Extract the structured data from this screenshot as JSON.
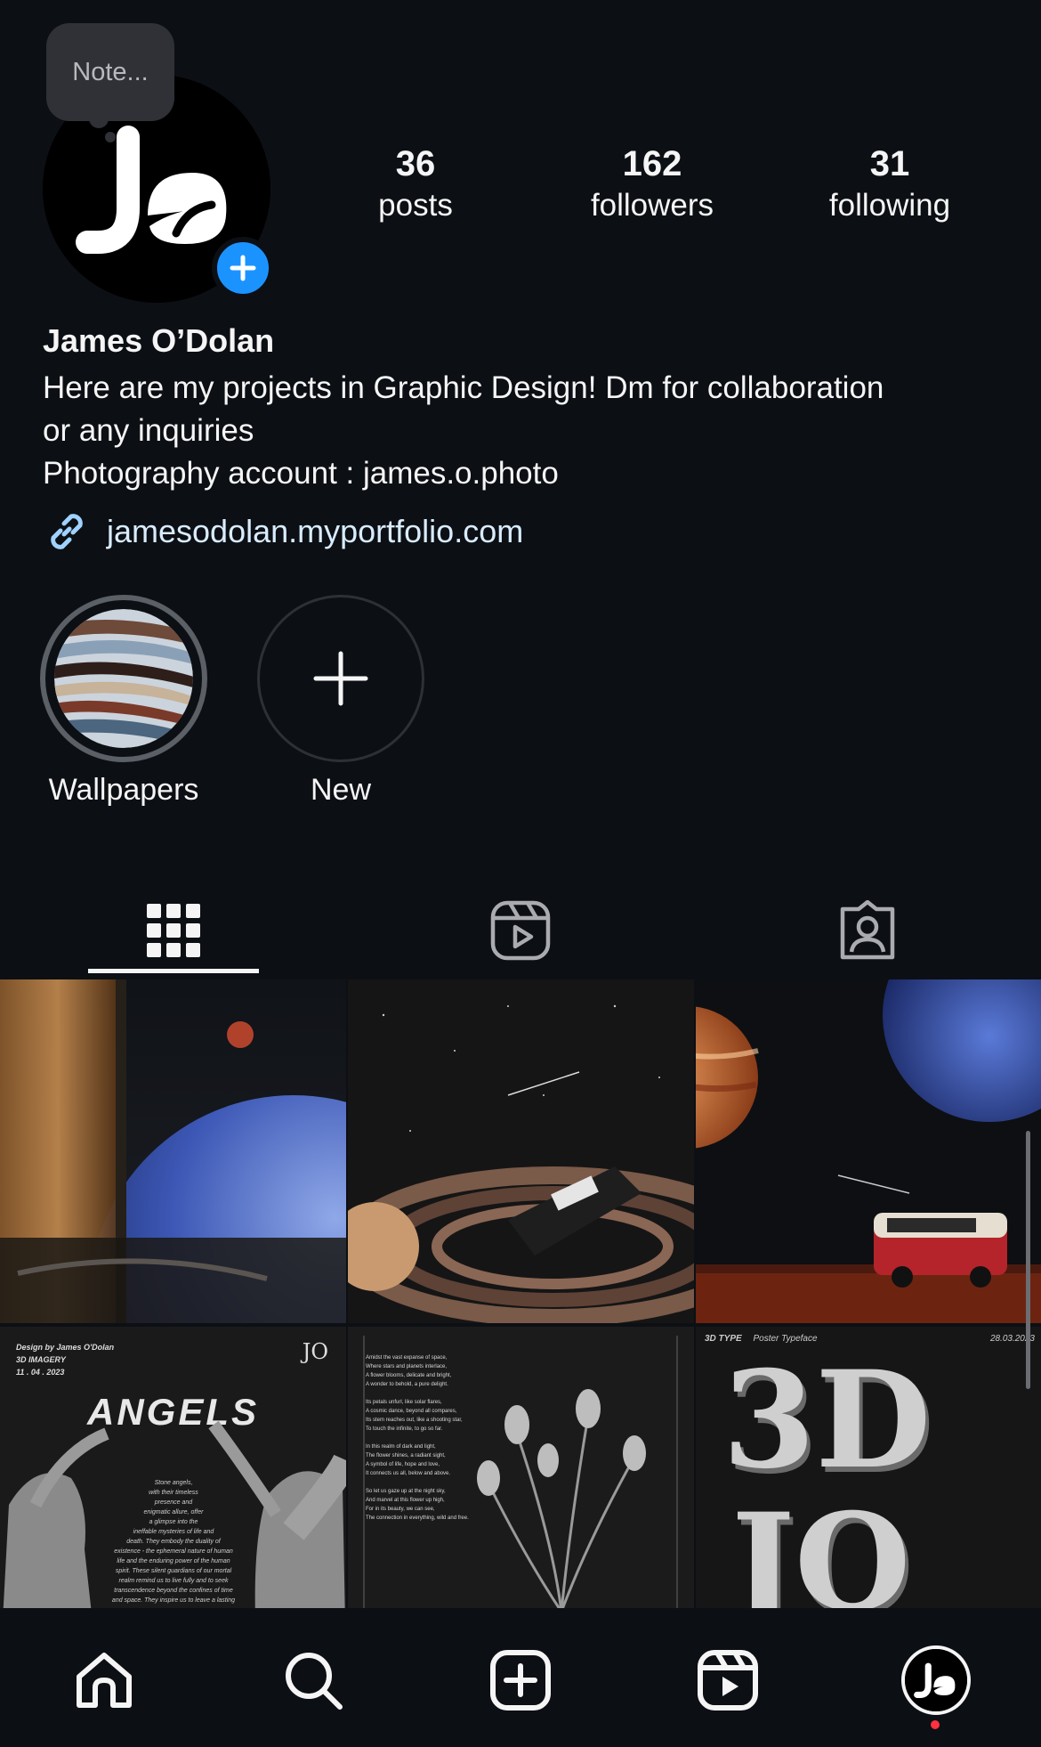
{
  "note": {
    "placeholder": "Note..."
  },
  "stats": [
    {
      "count": "36",
      "label": "posts"
    },
    {
      "count": "162",
      "label": "followers"
    },
    {
      "count": "31",
      "label": "following"
    }
  ],
  "profile": {
    "name": "James O’Dolan",
    "bio_lines": [
      "Here are my projects in Graphic Design! Dm for collaboration",
      "or any inquiries",
      "Photography account : james.o.photo"
    ],
    "link": "jamesodolan.myportfolio.com",
    "avatar_text": "Jo"
  },
  "highlights": [
    {
      "label": "Wallpapers"
    },
    {
      "label": "New"
    }
  ],
  "tabs": [
    {
      "icon": "grid-icon",
      "selected": true
    },
    {
      "icon": "reels-icon",
      "selected": false
    },
    {
      "icon": "tagged-icon",
      "selected": false
    }
  ],
  "posts": {
    "angels": {
      "credit": "Design by James O'Dolan",
      "subtitle": "3D IMAGERY",
      "date": "11 . 04 . 2023",
      "title": "ANGELS",
      "logo": "JO",
      "body": [
        "Stone angels,",
        "with their timeless",
        "presence and",
        "enigmatic allure, offer",
        "a glimpse into the",
        "ineffable mysteries of life and",
        "death. They embody the duality of",
        "existence - the ephemeral nature of human",
        "life and the enduring power of the human",
        "spirit. These silent guardians of our mortal",
        "realm remind us to live fully and to seek",
        "transcendence beyond the confines of time",
        "and space. They inspire us to leave a lasting"
      ]
    },
    "poem": {
      "lines": [
        "Amidst the vast expanse of space,",
        "Where stars and planets interlace,",
        "A flower blooms, delicate and bright,",
        "A wonder to behold, a pure delight.",
        "",
        "Its petals unfurl, like solar flares,",
        "A cosmic dance, beyond all compares,",
        "Its stem reaches out, like a shooting star,",
        "To touch the infinite, to go so far.",
        "",
        "In this realm of dark and light,",
        "The flower shines, a radiant sight,",
        "A symbol of life, hope and love,",
        "It connects us all, below and above.",
        "",
        "So let us gaze up at the night sky,",
        "And marvel at this flower up high,",
        "For in its beauty, we can see,",
        "The connection in everything, wild and free."
      ]
    },
    "type3d": {
      "label": "3D TYPE",
      "sublabel": "Poster Typeface",
      "date": "28.03.2023",
      "big1": "3D",
      "big2": "JO"
    }
  },
  "nav": [
    "home-icon",
    "search-icon",
    "create-icon",
    "reels-icon",
    "profile-avatar"
  ],
  "colors": {
    "background": "#0c0f14",
    "accent": "#1b93ff",
    "link": "#d9ecff",
    "notification": "#ff3040"
  }
}
